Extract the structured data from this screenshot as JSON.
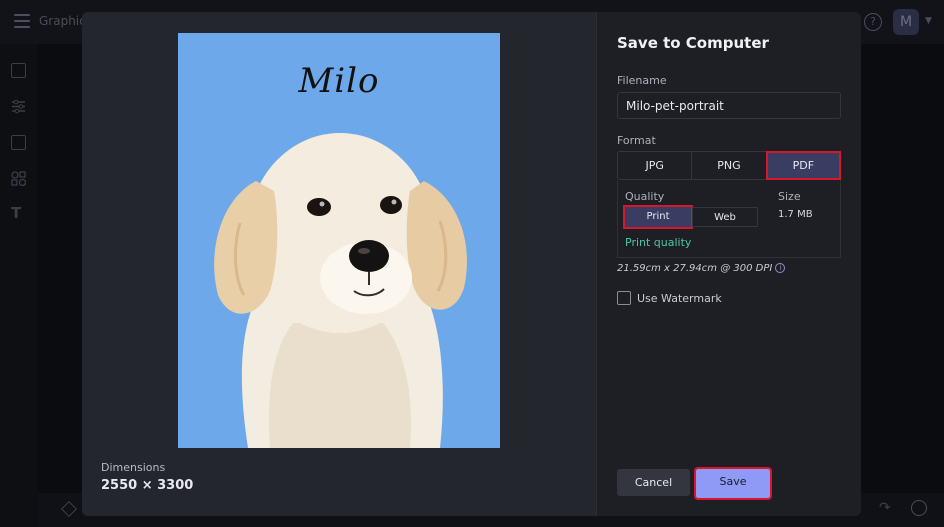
{
  "app": {
    "title": "Graphic",
    "avatar_initial": "M",
    "help_icon": "help-icon",
    "rail_icons": [
      "image-icon",
      "adjust-icon",
      "layout-icon",
      "elements-icon",
      "text-icon"
    ]
  },
  "preview": {
    "pet_name": "Milo",
    "background_color": "#6da9ea",
    "dimensions_label": "Dimensions",
    "dimensions_value": "2550 × 3300"
  },
  "settings": {
    "title": "Save to Computer",
    "filename_label": "Filename",
    "filename_value": "Milo-pet-portrait",
    "format_label": "Format",
    "formats": [
      "JPG",
      "PNG",
      "PDF"
    ],
    "selected_format": "PDF",
    "quality_label": "Quality",
    "quality_options": [
      "Print",
      "Web"
    ],
    "selected_quality": "Print",
    "quality_caption": "Print quality",
    "size_label": "Size",
    "size_value": "1.7 MB",
    "dpi_text": "21.59cm x 27.94cm @ 300 DPI",
    "watermark_label": "Use Watermark",
    "watermark_checked": false,
    "cancel_label": "Cancel",
    "save_label": "Save"
  },
  "colors": {
    "highlight": "#d9172a",
    "accent": "#8e9af5",
    "selected_bg": "#3a3d62",
    "quality_caption": "#4fc4a8"
  }
}
